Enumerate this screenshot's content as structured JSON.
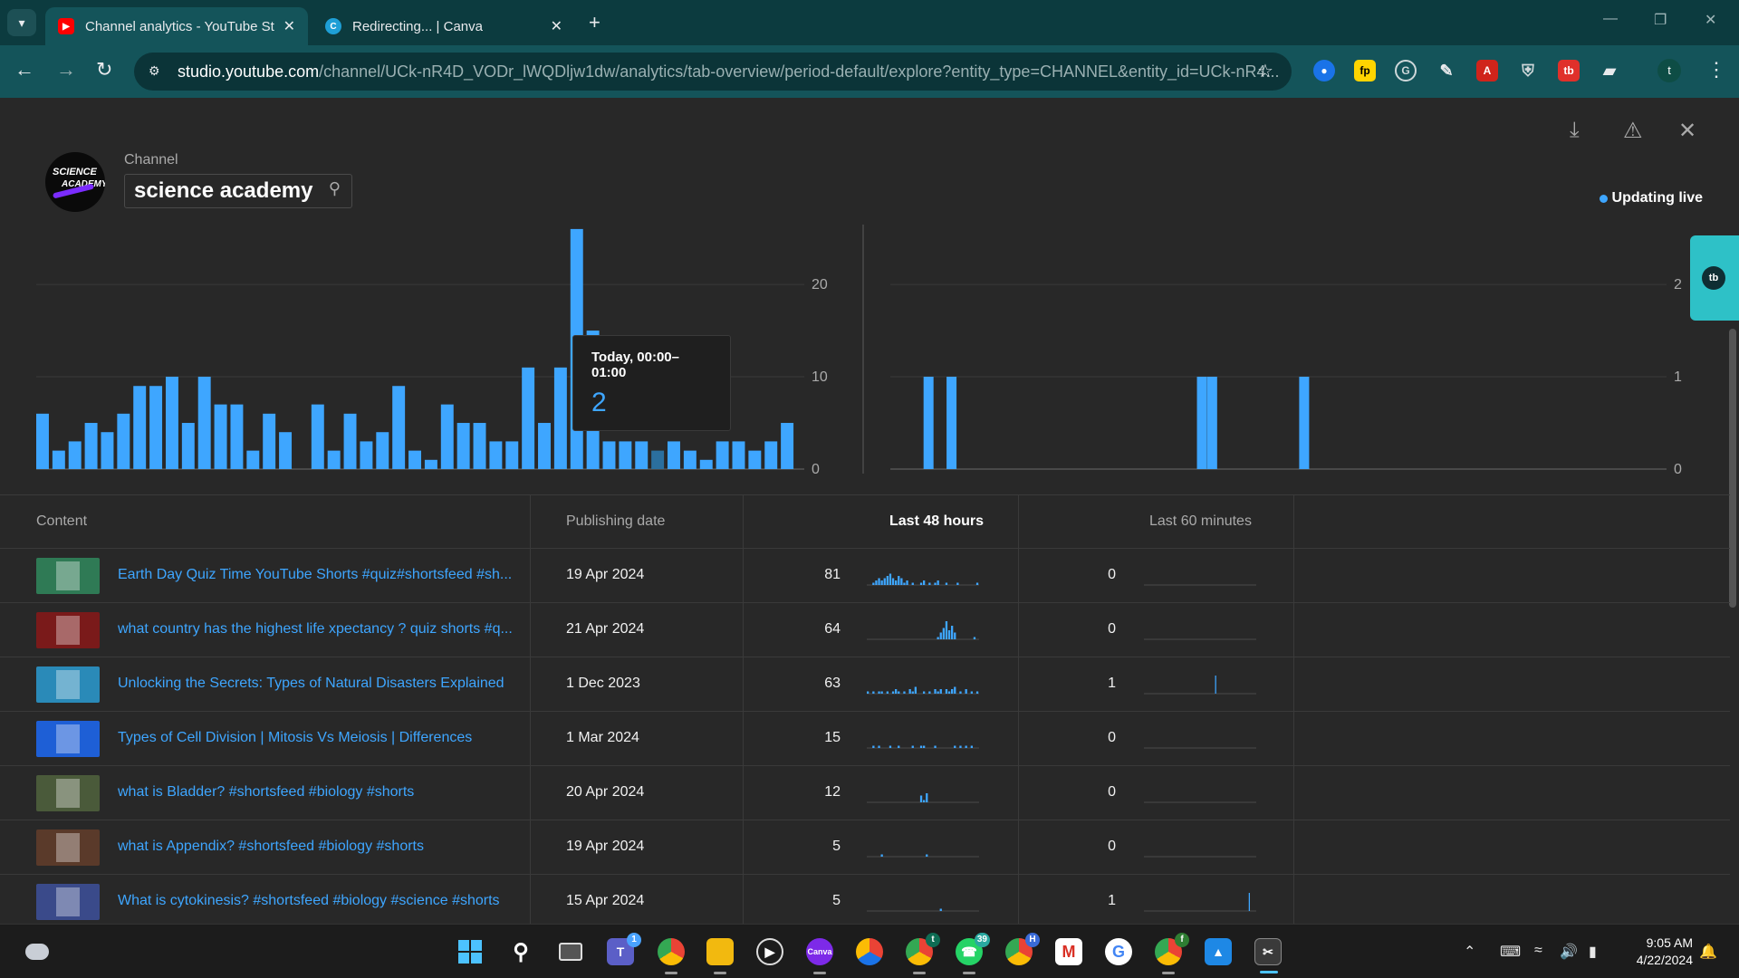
{
  "browser": {
    "tabs": [
      {
        "title": "Channel analytics - YouTube St",
        "icon": "youtube-icon"
      },
      {
        "title": "Redirecting... | Canva",
        "icon": "canva-icon"
      }
    ],
    "url_host": "studio.youtube.com",
    "url_path": "/channel/UCk-nR4D_VODr_lWQDljw1dw/analytics/tab-overview/period-default/explore?entity_type=CHANNEL&entity_id=UCk-nR4...",
    "profile_initial": "t",
    "extensions": [
      "meet-icon",
      "fp-icon",
      "grammarly-icon",
      "eyedropper-icon",
      "pdf-icon",
      "shield-icon",
      "tb-icon",
      "puzzle-icon"
    ]
  },
  "header": {
    "channel_label": "Channel",
    "channel_name": "science academy",
    "avatar_text_1": "SCIENCE",
    "avatar_text_2": "ACADEMY",
    "live_status": "Updating live"
  },
  "tooltip": {
    "label": "Today, 00:00–01:00",
    "value": "2"
  },
  "side_widget": {
    "logo": "tb"
  },
  "chart_data": [
    {
      "type": "bar",
      "title": "",
      "ylim": [
        0,
        25.5
      ],
      "y_ticks": [
        "0",
        "10",
        "20"
      ],
      "highlight_index": 38,
      "values": [
        6,
        2,
        3,
        5,
        4,
        6,
        9,
        9,
        10,
        5,
        10,
        7,
        7,
        2,
        6,
        4,
        0,
        7,
        2,
        6,
        3,
        4,
        9,
        2,
        1,
        7,
        5,
        5,
        3,
        3,
        11,
        5,
        11,
        26,
        15,
        3,
        3,
        3,
        2,
        3,
        2,
        1,
        3,
        3,
        2,
        3,
        5
      ]
    },
    {
      "type": "bar",
      "title": "",
      "ylim": [
        0,
        2.55
      ],
      "y_ticks": [
        "0",
        "1",
        "2"
      ],
      "values": [
        0,
        0,
        0,
        0,
        0,
        0,
        0,
        0,
        0,
        0,
        0,
        0,
        0,
        1,
        0,
        0,
        0,
        0,
        0,
        0,
        0,
        0,
        1,
        0,
        0,
        0,
        0,
        0,
        0,
        0,
        0,
        0,
        0,
        0,
        0,
        0,
        0,
        0,
        0,
        0,
        0,
        0,
        0,
        0,
        0,
        0,
        0,
        0,
        0,
        0,
        0,
        0,
        0,
        0,
        0,
        0,
        0,
        0,
        0,
        0,
        0,
        0,
        0,
        0,
        0,
        0,
        0,
        0,
        0,
        0,
        0,
        0,
        0,
        0,
        0,
        0,
        0,
        0,
        0,
        0,
        0,
        0,
        0,
        0,
        0,
        0,
        0,
        0,
        0,
        0,
        0,
        0,
        0,
        0,
        0,
        0,
        0,
        0,
        0,
        0,
        0,
        0,
        0,
        0,
        0,
        0,
        0,
        0,
        0,
        0,
        0,
        0,
        0,
        0,
        0,
        0,
        0,
        0,
        0,
        0,
        1,
        0,
        0,
        0,
        1,
        0,
        0,
        0,
        0,
        0,
        0,
        0,
        0,
        0,
        0,
        0,
        0,
        0,
        0,
        0,
        0,
        0,
        0,
        0,
        0,
        0,
        0,
        0,
        0,
        0,
        0,
        0,
        0,
        0,
        0,
        0,
        0,
        0,
        0,
        0,
        1,
        0,
        0,
        0,
        0,
        0,
        0,
        0,
        0,
        0,
        0,
        0,
        0,
        0,
        0,
        0,
        0,
        0,
        0,
        0,
        0,
        0,
        0,
        0,
        0,
        0,
        0,
        0,
        0,
        0,
        0,
        0,
        0,
        0,
        0,
        0,
        0,
        0,
        0,
        0,
        0,
        0,
        0,
        0,
        0,
        0,
        0,
        0,
        0,
        0,
        0,
        0,
        0,
        0,
        0,
        0,
        0,
        0,
        0,
        0,
        0,
        0,
        0,
        0,
        0,
        0,
        0,
        0,
        0,
        0,
        0,
        0,
        0,
        0,
        0,
        0,
        0,
        0,
        0,
        0,
        0,
        0,
        0,
        0,
        0,
        0,
        0,
        0,
        0,
        0,
        0,
        0,
        0,
        0,
        0,
        0,
        0,
        0,
        0,
        0,
        0,
        0,
        0,
        0,
        0,
        0,
        0,
        0,
        0,
        0,
        0,
        0,
        0,
        0,
        0,
        0,
        0,
        0,
        0,
        0,
        0,
        0,
        0,
        0,
        0,
        0,
        0,
        0,
        0,
        0,
        0,
        0,
        0,
        0,
        0,
        0,
        0,
        0,
        0,
        0,
        0,
        0
      ]
    }
  ],
  "table": {
    "headers": {
      "content": "Content",
      "publishing": "Publishing date",
      "h48": "Last 48 hours",
      "m60": "Last 60 minutes"
    },
    "rows": [
      {
        "title": "Earth Day Quiz Time YouTube Shorts #quiz#shortsfeed #sh...",
        "date": "19 Apr 2024",
        "h48": "81",
        "m60": "0",
        "thumb_color": "#2f7a55",
        "spark48": [
          0,
          0,
          1,
          2,
          3,
          2,
          3,
          4,
          5,
          3,
          2,
          4,
          3,
          1,
          2,
          0,
          1,
          0,
          0,
          1,
          2,
          0,
          1,
          0,
          1,
          2,
          0,
          0,
          1,
          0,
          0,
          0,
          1,
          0,
          0,
          0,
          0,
          0,
          0,
          1
        ],
        "spark60": []
      },
      {
        "title": "what country has the highest life xpectancy ? quiz shorts #q...",
        "date": "21 Apr 2024",
        "h48": "64",
        "m60": "0",
        "thumb_color": "#7a1a1a",
        "spark48": [
          0,
          0,
          0,
          0,
          0,
          0,
          0,
          0,
          0,
          0,
          0,
          0,
          0,
          0,
          0,
          0,
          0,
          0,
          0,
          0,
          0,
          0,
          0,
          0,
          0,
          1,
          3,
          5,
          8,
          4,
          6,
          3,
          0,
          0,
          0,
          0,
          0,
          0,
          1,
          0
        ],
        "spark60": []
      },
      {
        "title": "Unlocking the Secrets: Types of Natural Disasters Explained",
        "date": "1 Dec 2023",
        "h48": "63",
        "m60": "1",
        "thumb_color": "#2a8ab8",
        "spark48": [
          1,
          0,
          1,
          0,
          1,
          1,
          0,
          1,
          0,
          1,
          2,
          1,
          0,
          1,
          0,
          2,
          1,
          3,
          0,
          0,
          1,
          0,
          1,
          0,
          2,
          1,
          2,
          0,
          2,
          1,
          2,
          3,
          0,
          1,
          0,
          2,
          0,
          1,
          0,
          1
        ],
        "spark60": [
          0,
          0,
          0,
          0,
          0,
          0,
          0,
          0,
          0,
          0,
          0,
          0,
          0,
          0,
          0,
          0,
          0,
          0,
          0,
          0,
          0,
          0,
          0,
          0,
          0,
          0,
          0,
          0,
          0,
          0,
          0,
          0,
          0,
          0,
          0,
          0,
          0,
          0,
          1,
          0,
          0,
          0,
          0,
          0,
          0,
          0,
          0,
          0,
          0,
          0,
          0,
          0,
          0,
          0,
          0,
          0,
          0,
          0,
          0,
          0
        ]
      },
      {
        "title": "Types of Cell Division | Mitosis Vs Meiosis | Differences",
        "date": "1 Mar 2024",
        "h48": "15",
        "m60": "0",
        "thumb_color": "#1e5fd6",
        "spark48": [
          0,
          0,
          1,
          0,
          1,
          0,
          0,
          0,
          1,
          0,
          0,
          1,
          0,
          0,
          0,
          0,
          1,
          0,
          0,
          1,
          1,
          0,
          0,
          0,
          1,
          0,
          0,
          0,
          0,
          0,
          0,
          1,
          0,
          1,
          0,
          1,
          0,
          1,
          0,
          0
        ],
        "spark60": []
      },
      {
        "title": "what is Bladder? #shortsfeed #biology #shorts",
        "date": "20 Apr 2024",
        "h48": "12",
        "m60": "0",
        "thumb_color": "#4a5a3a",
        "spark48": [
          0,
          0,
          0,
          0,
          0,
          0,
          0,
          0,
          0,
          0,
          0,
          0,
          0,
          0,
          0,
          0,
          0,
          0,
          0,
          3,
          1,
          4,
          0,
          0,
          0,
          0,
          0,
          0,
          0,
          0,
          0,
          0,
          0,
          0,
          0,
          0,
          0,
          0,
          0,
          0
        ],
        "spark60": []
      },
      {
        "title": "what is Appendix? #shortsfeed #biology #shorts",
        "date": "19 Apr 2024",
        "h48": "5",
        "m60": "0",
        "thumb_color": "#5a3a2a",
        "spark48": [
          0,
          0,
          0,
          0,
          0,
          1,
          0,
          0,
          0,
          0,
          0,
          0,
          0,
          0,
          0,
          0,
          0,
          0,
          0,
          0,
          0,
          1,
          0,
          0,
          0,
          0,
          0,
          0,
          0,
          0,
          0,
          0,
          0,
          0,
          0,
          0,
          0,
          0,
          0,
          0
        ],
        "spark60": []
      },
      {
        "title": "What is cytokinesis? #shortsfeed #biology #science #shorts",
        "date": "15 Apr 2024",
        "h48": "5",
        "m60": "1",
        "thumb_color": "#3a4a8a",
        "spark48": [
          0,
          0,
          0,
          0,
          0,
          0,
          0,
          0,
          0,
          0,
          0,
          0,
          0,
          0,
          0,
          0,
          0,
          0,
          0,
          0,
          0,
          0,
          0,
          0,
          0,
          0,
          1,
          0,
          0,
          0,
          0,
          0,
          0,
          0,
          0,
          0,
          0,
          0,
          0,
          0
        ],
        "spark60": [
          0,
          0,
          0,
          0,
          0,
          0,
          0,
          0,
          0,
          0,
          0,
          0,
          0,
          0,
          0,
          0,
          0,
          0,
          0,
          0,
          0,
          0,
          0,
          0,
          0,
          0,
          0,
          0,
          0,
          0,
          0,
          0,
          0,
          0,
          0,
          0,
          0,
          0,
          0,
          0,
          0,
          0,
          0,
          0,
          0,
          0,
          0,
          0,
          0,
          0,
          0,
          0,
          0,
          0,
          0,
          0,
          1,
          0,
          0,
          0
        ]
      }
    ]
  },
  "taskbar": {
    "weather_icon": "cloud-icon",
    "badges": {
      "teams": "1",
      "chrome_t": "t",
      "whatsapp": "39",
      "chrome_h": "H",
      "chrome_f": "f"
    },
    "canva_label": "Canva",
    "time": "9:05 AM",
    "date": "4/22/2024"
  }
}
